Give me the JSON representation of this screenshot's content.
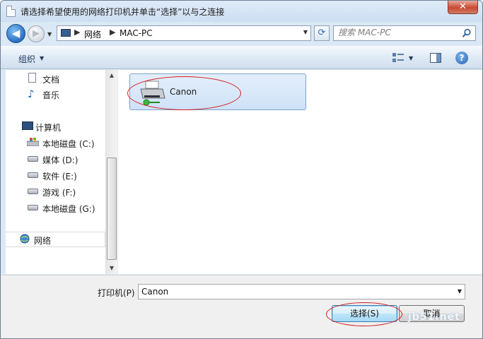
{
  "window": {
    "title": "请选择希望使用的网络打印机并单击“选择”以与之连接",
    "close_label": "✕"
  },
  "address_bar": {
    "crumbs": [
      "网络",
      "MAC-PC"
    ],
    "separator": "▶"
  },
  "search": {
    "placeholder": "搜索 MAC-PC"
  },
  "command_bar": {
    "organize_label": "组织"
  },
  "nav_pane": {
    "favorites": [
      {
        "label": "文档",
        "icon": "document-icon"
      },
      {
        "label": "音乐",
        "icon": "music-icon"
      }
    ],
    "computer": {
      "label": "计算机",
      "icon": "computer-icon"
    },
    "drives": [
      {
        "label": "本地磁盘 (C:)",
        "icon": "windows-drive-icon"
      },
      {
        "label": "媒体 (D:)",
        "icon": "drive-icon"
      },
      {
        "label": "软件 (E:)",
        "icon": "drive-icon"
      },
      {
        "label": "游戏 (F:)",
        "icon": "drive-icon"
      },
      {
        "label": "本地磁盘 (G:)",
        "icon": "drive-icon"
      }
    ],
    "network": {
      "label": "网络",
      "icon": "network-icon"
    }
  },
  "file_pane": {
    "items": [
      {
        "name": "Canon",
        "icon": "printer-icon",
        "selected": true
      }
    ]
  },
  "bottom": {
    "printer_label": "打印机(P)",
    "printer_value": "Canon",
    "select_button": "选择(S)",
    "cancel_button": "取消"
  },
  "watermark": "jb51.net",
  "colors": {
    "annotation_ellipse": "#d21c1c",
    "selection_fill": "#cfe2f8",
    "accent": "#2a6fc2"
  }
}
